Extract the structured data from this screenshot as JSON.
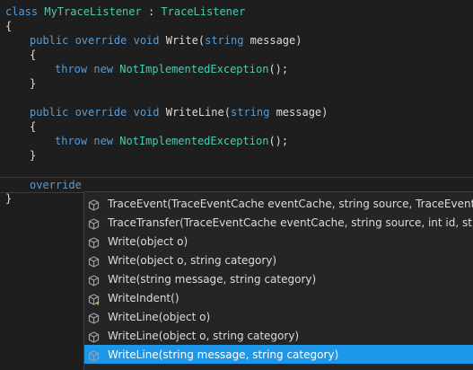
{
  "code": {
    "line1": {
      "kw": "class",
      "name": "MyTraceListener",
      "sep": " : ",
      "base": "TraceListener"
    },
    "brace_open": "{",
    "write_sig": {
      "kw": "public override void",
      "name": "Write",
      "paren": "(",
      "ptype": "string",
      "pname": " message)"
    },
    "inner_open": "{",
    "throw_stmt": {
      "kw": "throw new",
      "exc": "NotImplementedException",
      "tail": "();"
    },
    "inner_close": "}",
    "writeline_sig": {
      "kw": "public override void",
      "name": "WriteLine",
      "paren": "(",
      "ptype": "string",
      "pname": " message)"
    },
    "current_line": "override",
    "brace_close": "}"
  },
  "intellisense": {
    "icon_color": "#9aa0a6",
    "selected_color": "#1c97ea",
    "items": [
      {
        "label": "TraceEvent(TraceEventCache eventCache, string source, TraceEventType eventType, int id)",
        "icon": "method-cube-icon"
      },
      {
        "label": "TraceTransfer(TraceEventCache eventCache, string source, int id, string message, Guid relatedActivityId)",
        "icon": "method-cube-icon"
      },
      {
        "label": "Write(object o)",
        "icon": "method-cube-icon"
      },
      {
        "label": "Write(object o, string category)",
        "icon": "method-cube-icon"
      },
      {
        "label": "Write(string message, string category)",
        "icon": "method-cube-icon"
      },
      {
        "label": "WriteIndent()",
        "icon": "protected-method-cube-icon"
      },
      {
        "label": "WriteLine(object o)",
        "icon": "method-cube-icon"
      },
      {
        "label": "WriteLine(object o, string category)",
        "icon": "method-cube-icon"
      },
      {
        "label": "WriteLine(string message, string category)",
        "icon": "method-cube-icon",
        "selected": true
      }
    ]
  }
}
